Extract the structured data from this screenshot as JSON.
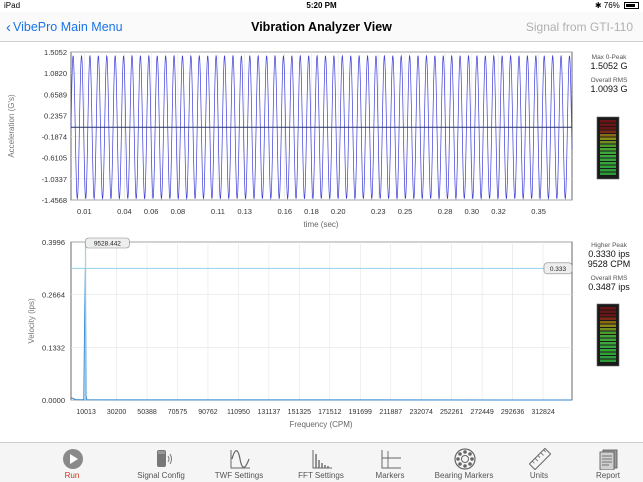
{
  "status_bar": {
    "device": "iPad",
    "time": "5:20 PM",
    "battery": "76%"
  },
  "nav": {
    "back_label": "VibePro Main Menu",
    "title": "Vibration Analyzer View",
    "signal_source": "Signal from GTI-110"
  },
  "twf_panel": {
    "peak_label": "Max 0-Peak",
    "peak_value": "1.5052 G",
    "rms_label": "Overall RMS",
    "rms_value": "1.0093 G"
  },
  "fft_panel": {
    "peak_label": "Higher Peak",
    "peak_ips": "0.3330 ips",
    "peak_cpm": "9528 CPM",
    "rms_label": "Overall RMS",
    "rms_value": "0.3487 ips"
  },
  "tabs": [
    {
      "label": "Run",
      "icon": "run-icon"
    },
    {
      "label": "Signal Config",
      "icon": "sensor-icon"
    },
    {
      "label": "TWF Settings",
      "icon": "waveform-icon"
    },
    {
      "label": "FFT Settings",
      "icon": "spectrum-icon"
    },
    {
      "label": "Markers",
      "icon": "markers-icon"
    },
    {
      "label": "Bearing Markers",
      "icon": "bearing-icon"
    },
    {
      "label": "Units",
      "icon": "ruler-icon"
    },
    {
      "label": "Report",
      "icon": "report-icon"
    }
  ],
  "chart_data": [
    {
      "type": "line",
      "title": "",
      "xlabel": "time (sec)",
      "ylabel": "Acceleration (G's)",
      "x_ticks": [
        "0.01",
        "0.04",
        "0.06",
        "0.08",
        "0.11",
        "0.13",
        "0.16",
        "0.18",
        "0.20",
        "0.23",
        "0.25",
        "0.28",
        "0.30",
        "0.32",
        "0.35"
      ],
      "y_ticks": [
        "1.5052",
        "1.0820",
        "0.6589",
        "0.2357",
        "-0.1874",
        "-0.6105",
        "-1.0337",
        "-1.4568"
      ],
      "xlim": [
        0,
        0.375
      ],
      "ylim": [
        -1.4568,
        1.5052
      ],
      "series": [
        {
          "waveform": "sine",
          "amplitude": 1.43,
          "frequency_hz": 158.8,
          "color": "#3a3ad8"
        }
      ],
      "zero_line_color": "#27306b",
      "grid": true
    },
    {
      "type": "line",
      "title": "",
      "xlabel": "Frequency (CPM)",
      "ylabel": "Velocity (ips)",
      "x_ticks": [
        "10013",
        "30200",
        "50388",
        "70575",
        "90762",
        "110950",
        "131137",
        "151325",
        "171512",
        "191699",
        "211887",
        "232074",
        "252261",
        "272449",
        "292636",
        "312824"
      ],
      "y_ticks": [
        "0.3996",
        "0.2664",
        "0.1332",
        "0.0000"
      ],
      "xlim": [
        0,
        332000
      ],
      "ylim": [
        0,
        0.3996
      ],
      "series": [
        {
          "points": [
            [
              0,
              0.006
            ],
            [
              1500,
              0.004
            ],
            [
              3000,
              0.001
            ],
            [
              6500,
              0.0005
            ],
            [
              8500,
              0.0005
            ],
            [
              9100,
              0.23
            ],
            [
              9528,
              0.333
            ],
            [
              9950,
              0.01
            ],
            [
              10500,
              0.0005
            ],
            [
              332000,
              0.0
            ]
          ],
          "color": "#2f88d4"
        }
      ],
      "peak_marker": {
        "label": "9528.442",
        "x": 9528
      },
      "level_marker": {
        "label": "0.333",
        "y": 0.333,
        "color": "#8fd3e8"
      },
      "grid": true
    }
  ]
}
